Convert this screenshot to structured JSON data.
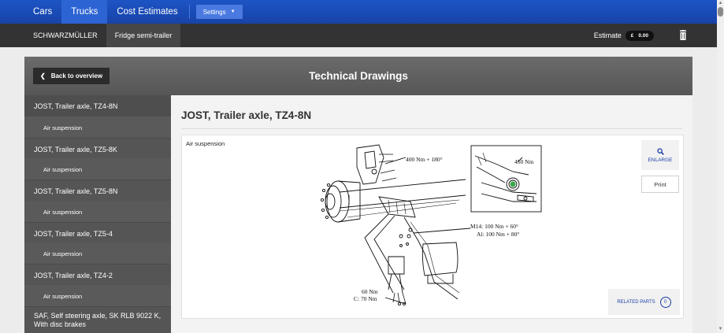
{
  "topnav": {
    "items": [
      "Cars",
      "Trucks",
      "Cost Estimates"
    ],
    "active_index": 1,
    "settings_label": "Settings"
  },
  "subnav": {
    "crumbs": [
      "SCHWARZMÜLLER",
      "Fridge semi-trailer"
    ],
    "estimate_label": "Estimate",
    "estimate_currency": "£",
    "estimate_value": "0.00"
  },
  "panel": {
    "back_label": "Back to overview",
    "title": "Technical Drawings"
  },
  "sidebar": {
    "items": [
      {
        "label": "JOST, Trailer axle, TZ4-8N",
        "sub": "Air suspension"
      },
      {
        "label": "JOST, Trailer axle, TZ5-8K",
        "sub": "Air suspension"
      },
      {
        "label": "JOST, Trailer axle, TZ5-8N",
        "sub": "Air suspension"
      },
      {
        "label": "JOST, Trailer axle, TZ5-4",
        "sub": "Air suspension"
      },
      {
        "label": "JOST, Trailer axle, TZ4-2",
        "sub": "Air suspension"
      },
      {
        "label": "SAF, Self steering axle, SK RLB 9022 K, With disc brakes",
        "sub": ""
      }
    ]
  },
  "content": {
    "title": "JOST, Trailer axle, TZ4-8N",
    "drawing_label": "Air suspension",
    "annotations": {
      "torque_top": "400 Nm + 180°",
      "torque_inset": "450 Nm",
      "m14": "M14: 100 Nm + 60°",
      "al": "Al: 100 Nm + 80°",
      "bottom1": "60 Nm",
      "bottom2": "C: 70 Nm"
    },
    "enlarge_label": "ENLARGE",
    "print_label": "Print",
    "related_label": "RELATED PARTS",
    "related_count": "0"
  },
  "colors": {
    "nav_blue": "#1d54c4",
    "subnav_dark": "#333333",
    "link_blue": "#1a3fa6"
  }
}
